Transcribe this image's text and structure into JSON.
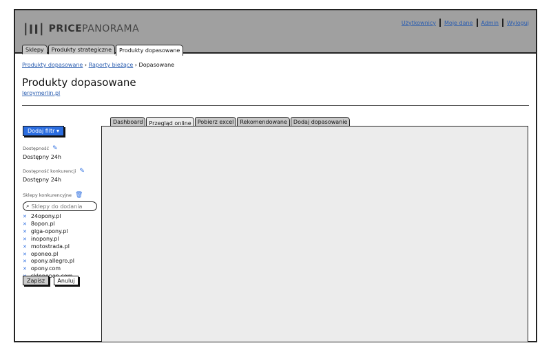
{
  "header": {
    "logo_bold": "PRICE",
    "logo_light": "PANORAMA",
    "links": [
      "Użytkownicy",
      "Moje dane",
      "Admin",
      "Wyloguj"
    ]
  },
  "tabs": [
    "Sklepy",
    "Produkty strategiczne",
    "Produkty dopasowane"
  ],
  "breadcrumb": [
    "Produkty dopasowane",
    "Raporty bieżące",
    "Dopasowane"
  ],
  "page": {
    "title": "Produkty dopasowane",
    "sublink": "leroymerlin.pl"
  },
  "filters": {
    "add_button": "Dodaj filtr",
    "availability_label": "Dostępność",
    "availability_value": "Dostępny 24h",
    "comp_availability_label": "Dostępność konkurencji",
    "comp_availability_value": "Dostępny 24h",
    "shops_label": "Sklepy konkurencyjne",
    "search_placeholder": "Sklepy do dodania",
    "shops": [
      "24opony.pl",
      "8opon.pl",
      "giga-opony.pl",
      "inopony.pl",
      "motostrada.pl",
      "oponeo.pl",
      "opony.allegro.pl",
      "opony.com",
      "sklepopon.com"
    ],
    "save": "Zapisz",
    "cancel": "Anuluj"
  },
  "panel_tabs": [
    "Dashboard",
    "Przegląd online",
    "Pobierz excel",
    "Rekomendowane",
    "Dodaj dopasowanie"
  ]
}
